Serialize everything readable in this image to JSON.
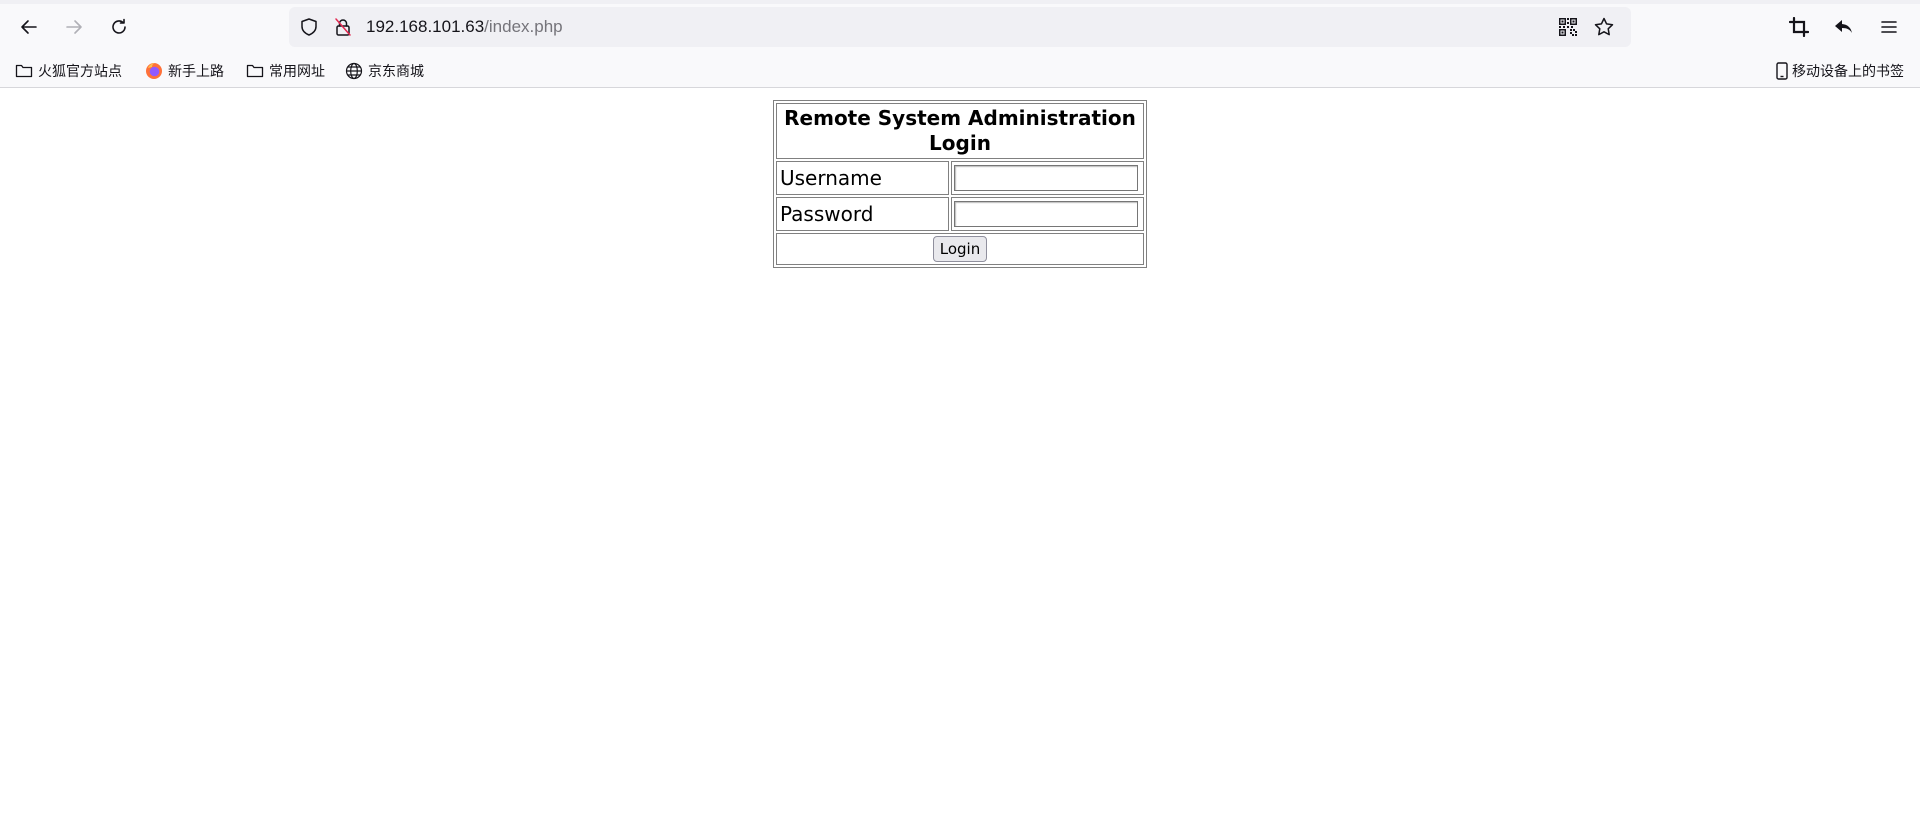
{
  "browser": {
    "url": {
      "host": "192.168.101.63",
      "path": "/index.php"
    },
    "bookmarks": [
      {
        "label": "火狐官方站点",
        "icon": "folder-icon"
      },
      {
        "label": "新手上路",
        "icon": "firefox-icon"
      },
      {
        "label": "常用网址",
        "icon": "folder-icon"
      },
      {
        "label": "京东商城",
        "icon": "globe-icon"
      }
    ],
    "mobile_bookmarks": "移动设备上的书签"
  },
  "login": {
    "title": "Remote System Administration Login",
    "username_label": "Username",
    "username_value": "",
    "password_label": "Password",
    "password_value": "",
    "submit_label": "Login"
  }
}
